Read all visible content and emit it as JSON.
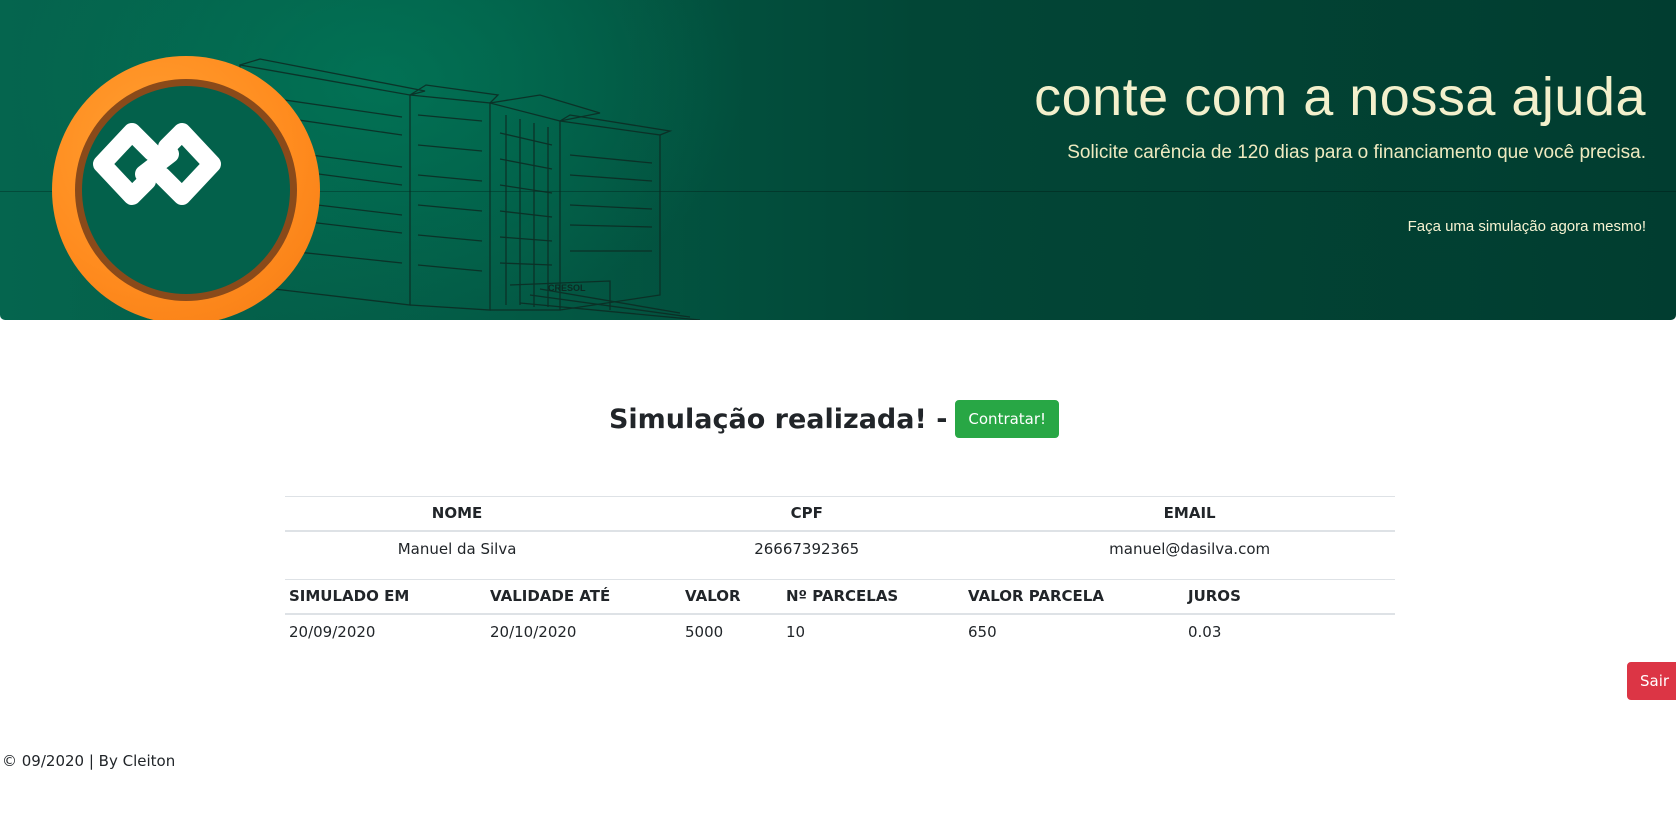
{
  "banner": {
    "title": "conte com a nossa ajuda",
    "subtitle": "Solicite carência de 120 dias para o financiamento que você precisa.",
    "cta": "Faça uma simulação agora mesmo!",
    "building_sign": "CRESOL",
    "colors": {
      "background": "#024636",
      "logo_ring": "#ff8c1f",
      "text": "#f3f0cc"
    }
  },
  "result": {
    "title": "Simulação realizada! -",
    "contract_button": "Contratar!"
  },
  "client_table": {
    "headers": [
      "NOME",
      "CPF",
      "EMAIL"
    ],
    "row": [
      "Manuel da Silva",
      "26667392365",
      "manuel@dasilva.com"
    ]
  },
  "simulation_table": {
    "headers": [
      "SIMULADO EM",
      "VALIDADE ATÉ",
      "VALOR",
      "Nº PARCELAS",
      "VALOR PARCELA",
      "JUROS"
    ],
    "row": [
      "20/09/2020",
      "20/10/2020",
      "5000",
      "10",
      "650",
      "0.03"
    ]
  },
  "actions": {
    "logout_button": "Sair",
    "colors": {
      "success": "#28a745",
      "danger": "#dc3545"
    }
  },
  "footer": {
    "text": "© 09/2020 | By Cleiton"
  }
}
